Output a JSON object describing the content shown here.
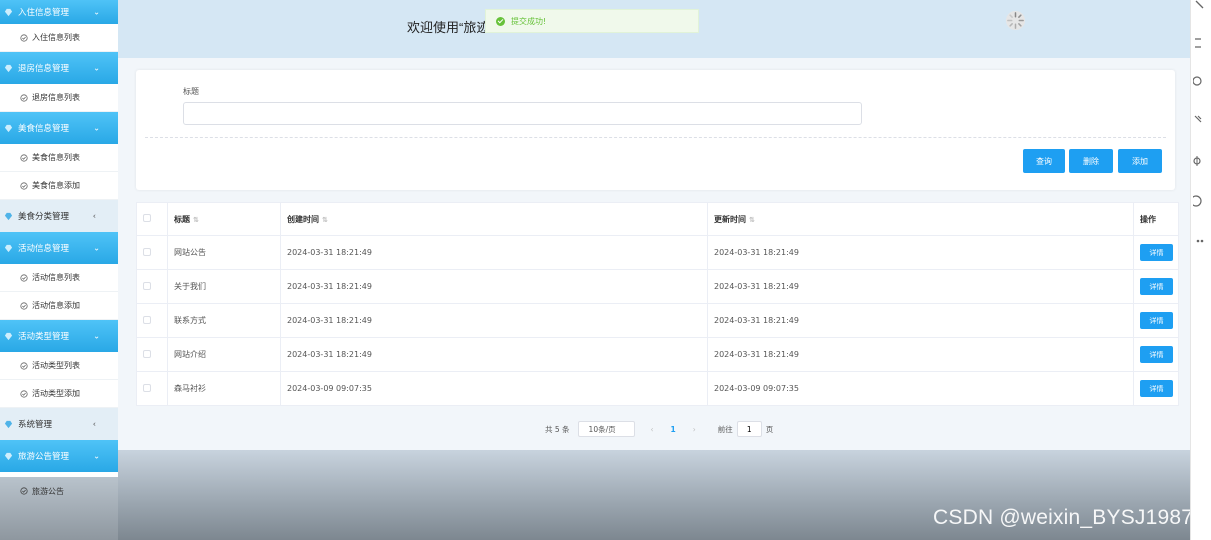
{
  "sidebar": {
    "groups": [
      {
        "label": "入住信息管理",
        "items": [
          "入住信息列表"
        ]
      },
      {
        "label": "退房信息管理",
        "items": [
          "退房信息列表"
        ]
      },
      {
        "label": "美食信息管理",
        "items": [
          "美食信息列表",
          "美食信息添加"
        ]
      },
      {
        "label": "美食分类管理",
        "items": []
      },
      {
        "label": "活动信息管理",
        "items": [
          "活动信息列表",
          "活动信息添加"
        ]
      },
      {
        "label": "活动类型管理",
        "items": [
          "活动类型列表",
          "活动类型添加"
        ]
      },
      {
        "label": "系统管理",
        "items": []
      },
      {
        "label": "旅游公告管理",
        "items": [
          "旅游公告"
        ]
      }
    ]
  },
  "header": {
    "welcome": "欢迎使用“旅迹",
    "toast": "提交成功!"
  },
  "search": {
    "title_label": "标题",
    "title_value": "",
    "query_label": "查询",
    "delete_label": "删除",
    "add_label": "添加"
  },
  "table": {
    "columns": [
      "标题",
      "创建时间",
      "更新时间",
      "操作"
    ],
    "rows": [
      {
        "title": "网站公告",
        "created": "2024-03-31 18:21:49",
        "updated": "2024-03-31 18:21:49",
        "action": "详情"
      },
      {
        "title": "关于我们",
        "created": "2024-03-31 18:21:49",
        "updated": "2024-03-31 18:21:49",
        "action": "详情"
      },
      {
        "title": "联系方式",
        "created": "2024-03-31 18:21:49",
        "updated": "2024-03-31 18:21:49",
        "action": "详情"
      },
      {
        "title": "网站介绍",
        "created": "2024-03-31 18:21:49",
        "updated": "2024-03-31 18:21:49",
        "action": "详情"
      },
      {
        "title": "森马衬衫",
        "created": "2024-03-09 09:07:35",
        "updated": "2024-03-09 09:07:35",
        "action": "详情"
      }
    ]
  },
  "pagination": {
    "total": "共 5 条",
    "page_size": "10条/页",
    "prev": "‹",
    "current_page": "1",
    "next": "›",
    "goto_label": "前往",
    "goto_value": "1",
    "page_suffix": "页"
  },
  "watermark": "CSDN @weixin_BYSJ1987",
  "colors": {
    "accent": "#1e9ff2",
    "sidebar_active": "#29a8e6",
    "banner": "#d5e7f4",
    "success": "#67c23a"
  }
}
